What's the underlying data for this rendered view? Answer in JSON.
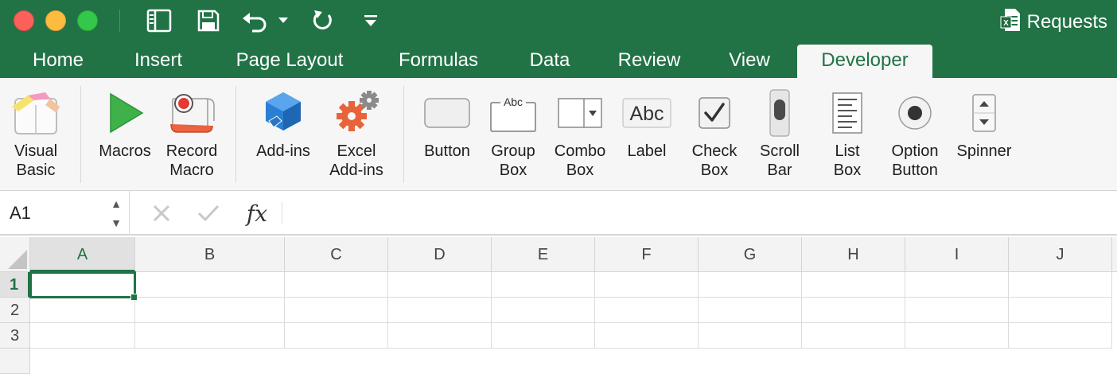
{
  "window": {
    "title": "Requests",
    "accent": "#217346",
    "traffic_lights": [
      "close",
      "minimize",
      "zoom"
    ]
  },
  "quick_access": [
    {
      "name": "sidebar-toggle-icon"
    },
    {
      "name": "save-icon"
    },
    {
      "name": "undo-icon"
    },
    {
      "name": "undo-dropdown-icon"
    },
    {
      "name": "redo-icon"
    },
    {
      "name": "customize-toolbar-icon"
    }
  ],
  "tabs": [
    {
      "label": "Home"
    },
    {
      "label": "Insert"
    },
    {
      "label": "Page Layout"
    },
    {
      "label": "Formulas"
    },
    {
      "label": "Data"
    },
    {
      "label": "Review"
    },
    {
      "label": "View"
    },
    {
      "label": "Developer",
      "active": true
    }
  ],
  "ribbon": {
    "buttons": [
      {
        "label": "Visual\nBasic",
        "icon": "visual-basic-icon"
      },
      {
        "label": "Macros",
        "icon": "play-icon"
      },
      {
        "label": "Record\nMacro",
        "icon": "record-macro-icon"
      },
      {
        "label": "Add-ins",
        "icon": "add-ins-icon"
      },
      {
        "label": "Excel\nAdd-ins",
        "icon": "gears-icon"
      },
      {
        "label": "Button",
        "icon": "button-control-icon"
      },
      {
        "label": "Group\nBox",
        "icon": "group-box-icon"
      },
      {
        "label": "Combo\nBox",
        "icon": "combo-box-icon"
      },
      {
        "label": "Label",
        "icon": "label-control-icon"
      },
      {
        "label": "Check\nBox",
        "icon": "check-box-icon"
      },
      {
        "label": "Scroll\nBar",
        "icon": "scroll-bar-icon"
      },
      {
        "label": "List\nBox",
        "icon": "list-box-icon"
      },
      {
        "label": "Option\nButton",
        "icon": "option-button-icon"
      },
      {
        "label": "Spinner",
        "icon": "spinner-icon"
      }
    ],
    "icon_text": {
      "group_box": "Abc",
      "label": "Abc"
    }
  },
  "formula_bar": {
    "name_box": "A1",
    "cancel_icon": "x-icon",
    "enter_icon": "checkmark-icon",
    "fx": "fx",
    "value": ""
  },
  "sheet": {
    "columns": [
      "A",
      "B",
      "C",
      "D",
      "E",
      "F",
      "G",
      "H",
      "I",
      "J"
    ],
    "rows": [
      "1",
      "2",
      "3"
    ],
    "selected_cell": "A1"
  }
}
